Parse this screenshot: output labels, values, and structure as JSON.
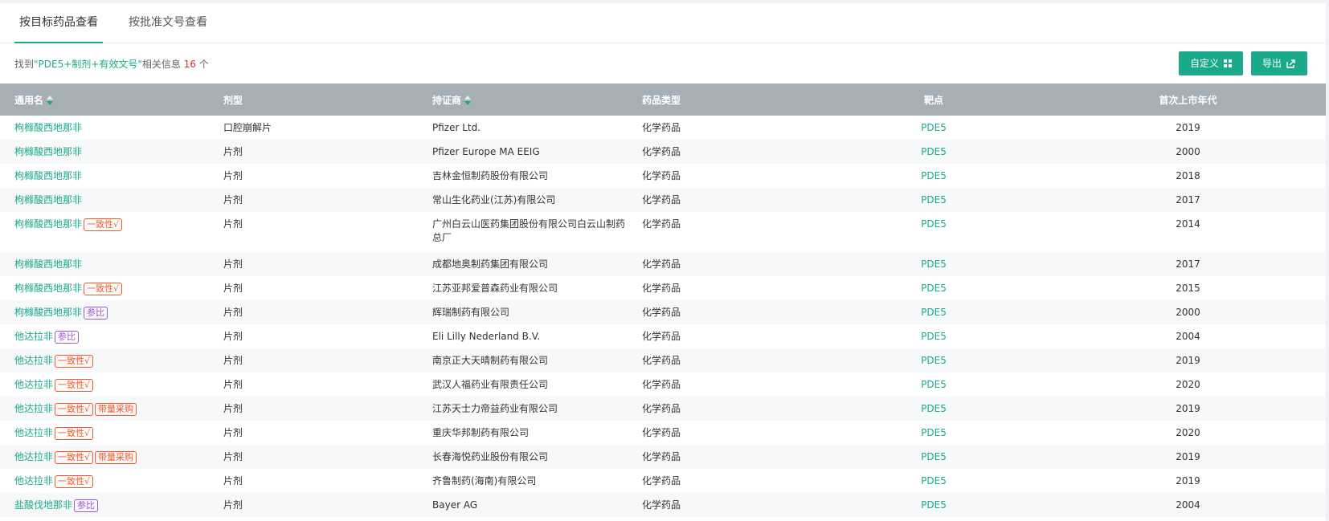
{
  "tabs": [
    {
      "label": "按目标药品查看",
      "active": true
    },
    {
      "label": "按批准文号查看",
      "active": false
    }
  ],
  "summary": {
    "prefix": "找到",
    "query": "\"PDE5+制剂+有效文号\"",
    "middle": "相关信息 ",
    "count": "16",
    "suffix": " 个"
  },
  "buttons": {
    "customize_label": "自定义",
    "export_label": "导出"
  },
  "table": {
    "headers": [
      "通用名",
      "剂型",
      "持证商",
      "药品类型",
      "靶点",
      "首次上市年代"
    ],
    "rows": [
      {
        "name": "枸橼酸西地那非",
        "tags": [],
        "form": "口腔崩解片",
        "holder": "Pfizer Ltd.",
        "type": "化学药品",
        "target": "PDE5",
        "year": "2019"
      },
      {
        "name": "枸橼酸西地那非",
        "tags": [],
        "form": "片剂",
        "holder": "Pfizer Europe MA EEIG",
        "type": "化学药品",
        "target": "PDE5",
        "year": "2000"
      },
      {
        "name": "枸橼酸西地那非",
        "tags": [],
        "form": "片剂",
        "holder": "吉林金恒制药股份有限公司",
        "type": "化学药品",
        "target": "PDE5",
        "year": "2018"
      },
      {
        "name": "枸橼酸西地那非",
        "tags": [],
        "form": "片剂",
        "holder": "常山生化药业(江苏)有限公司",
        "type": "化学药品",
        "target": "PDE5",
        "year": "2017"
      },
      {
        "name": "枸橼酸西地那非",
        "tags": [
          {
            "text": "一致性√",
            "color": "red"
          }
        ],
        "form": "片剂",
        "holder": "广州白云山医药集团股份有限公司白云山制药总厂",
        "type": "化学药品",
        "target": "PDE5",
        "year": "2014",
        "tall": true
      },
      {
        "name": "枸橼酸西地那非",
        "tags": [],
        "form": "片剂",
        "holder": "成都地奥制药集团有限公司",
        "type": "化学药品",
        "target": "PDE5",
        "year": "2017"
      },
      {
        "name": "枸橼酸西地那非",
        "tags": [
          {
            "text": "一致性√",
            "color": "red"
          }
        ],
        "form": "片剂",
        "holder": "江苏亚邦爱普森药业有限公司",
        "type": "化学药品",
        "target": "PDE5",
        "year": "2015"
      },
      {
        "name": "枸橼酸西地那非",
        "tags": [
          {
            "text": "参比",
            "color": "purple"
          }
        ],
        "form": "片剂",
        "holder": "辉瑞制药有限公司",
        "type": "化学药品",
        "target": "PDE5",
        "year": "2000"
      },
      {
        "name": "他达拉非",
        "tags": [
          {
            "text": "参比",
            "color": "purple"
          }
        ],
        "form": "片剂",
        "holder": "Eli Lilly Nederland B.V.",
        "type": "化学药品",
        "target": "PDE5",
        "year": "2004"
      },
      {
        "name": "他达拉非",
        "tags": [
          {
            "text": "一致性√",
            "color": "red"
          }
        ],
        "form": "片剂",
        "holder": "南京正大天晴制药有限公司",
        "type": "化学药品",
        "target": "PDE5",
        "year": "2019"
      },
      {
        "name": "他达拉非",
        "tags": [
          {
            "text": "一致性√",
            "color": "red"
          }
        ],
        "form": "片剂",
        "holder": "武汉人福药业有限责任公司",
        "type": "化学药品",
        "target": "PDE5",
        "year": "2020"
      },
      {
        "name": "他达拉非",
        "tags": [
          {
            "text": "一致性√",
            "color": "red"
          },
          {
            "text": "带量采购",
            "color": "red"
          }
        ],
        "form": "片剂",
        "holder": "江苏天士力帝益药业有限公司",
        "type": "化学药品",
        "target": "PDE5",
        "year": "2019"
      },
      {
        "name": "他达拉非",
        "tags": [
          {
            "text": "一致性√",
            "color": "red"
          }
        ],
        "form": "片剂",
        "holder": "重庆华邦制药有限公司",
        "type": "化学药品",
        "target": "PDE5",
        "year": "2020"
      },
      {
        "name": "他达拉非",
        "tags": [
          {
            "text": "一致性√",
            "color": "red"
          },
          {
            "text": "带量采购",
            "color": "red"
          }
        ],
        "form": "片剂",
        "holder": "长春海悦药业股份有限公司",
        "type": "化学药品",
        "target": "PDE5",
        "year": "2019"
      },
      {
        "name": "他达拉非",
        "tags": [
          {
            "text": "一致性√",
            "color": "red"
          }
        ],
        "form": "片剂",
        "holder": "齐鲁制药(海南)有限公司",
        "type": "化学药品",
        "target": "PDE5",
        "year": "2019"
      },
      {
        "name": "盐酸伐地那非",
        "tags": [
          {
            "text": "参比",
            "color": "purple"
          }
        ],
        "form": "片剂",
        "holder": "Bayer AG",
        "type": "化学药品",
        "target": "PDE5",
        "year": "2004"
      }
    ]
  },
  "colors": {
    "accent": "#1aaa8b",
    "header_bg": "#a6afb5",
    "count": "#e0282e",
    "tag_red": "#f05a28",
    "tag_purple": "#9b59d0"
  },
  "icons": {
    "customize": "grid-icon",
    "export": "export-icon",
    "sort": "sort-icon"
  }
}
